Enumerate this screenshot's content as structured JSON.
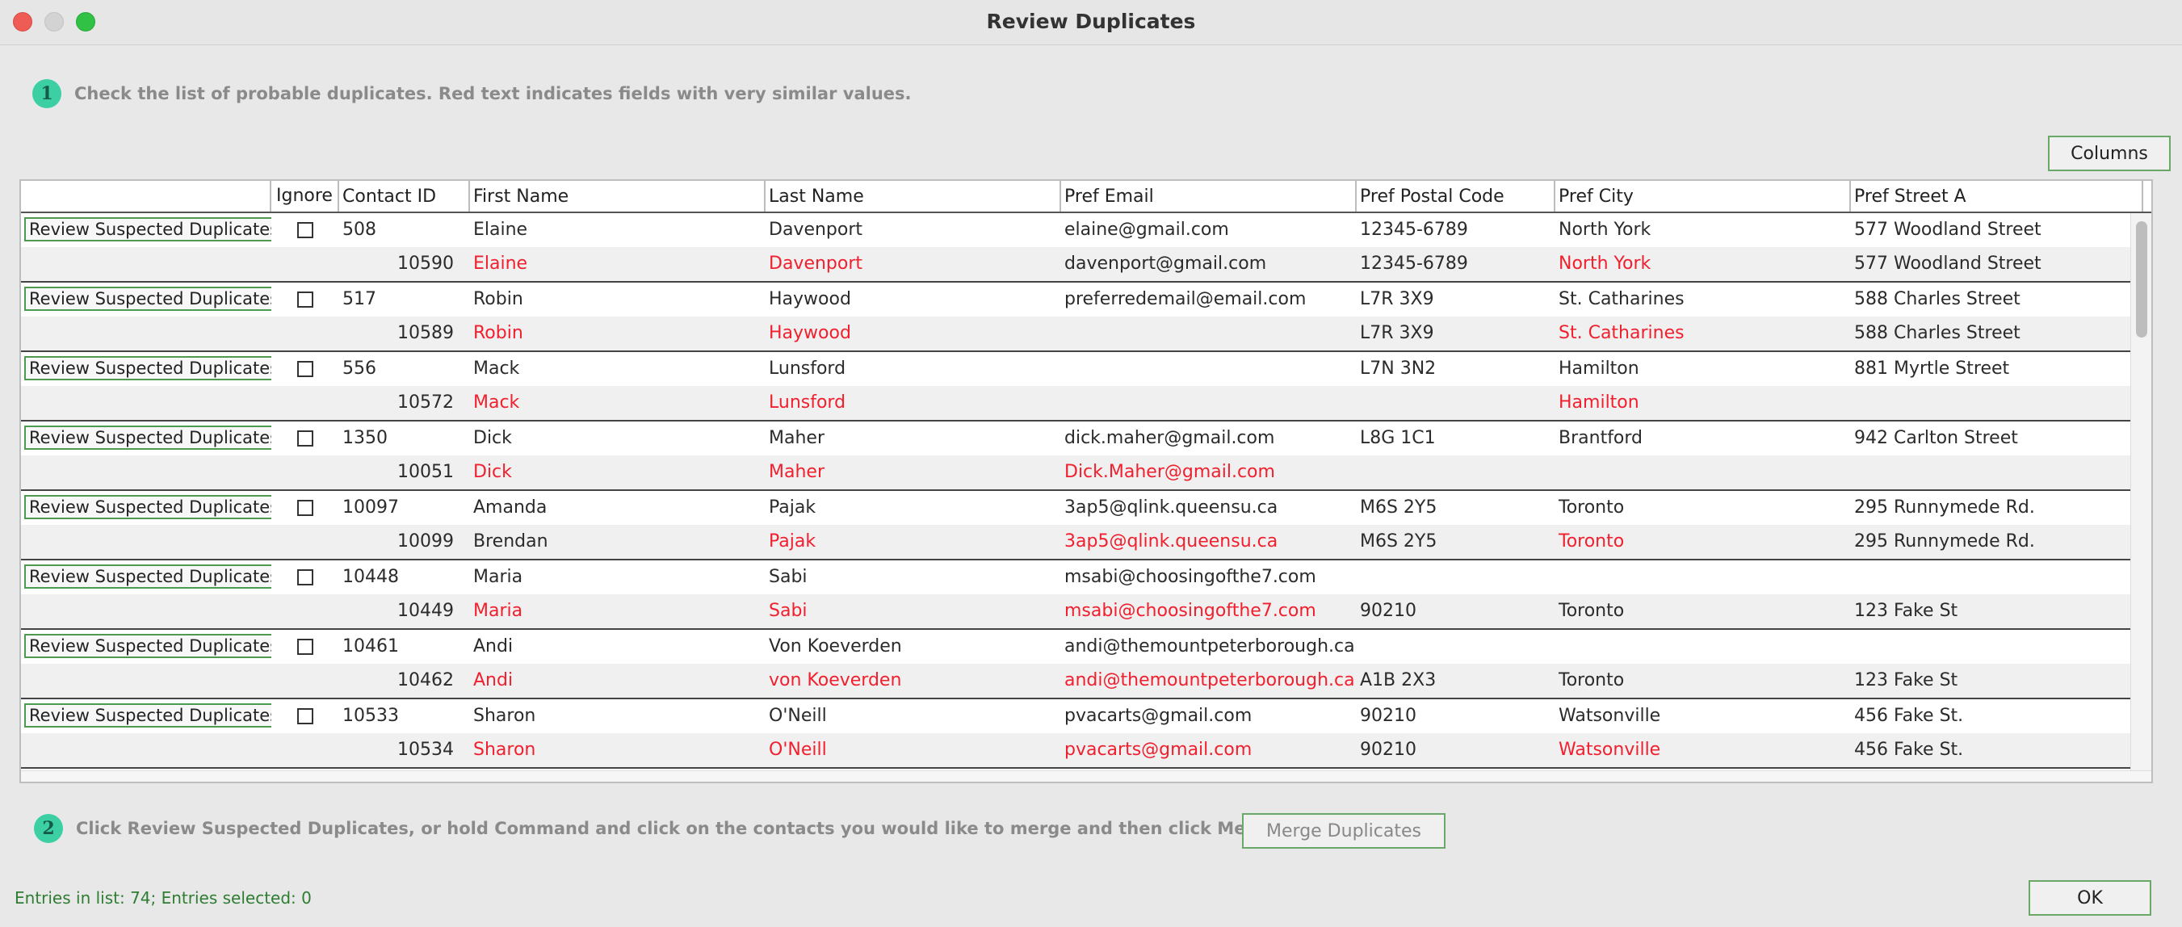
{
  "window": {
    "title": "Review Duplicates"
  },
  "step1": {
    "num": "1",
    "text": "Check the list of probable duplicates. Red text indicates fields with very similar values."
  },
  "step2": {
    "num": "2",
    "text": "Click Review Suspected Duplicates, or hold Command and click on the contacts you would like to merge and then click Merge Duplicates."
  },
  "buttons": {
    "columns": "Columns",
    "merge": "Merge Duplicates",
    "ok": "OK",
    "review": "Review Suspected Duplicates"
  },
  "table": {
    "headers": [
      "",
      "Ignore",
      "Contact ID",
      "First Name",
      "Last Name",
      "Pref Email",
      "Pref Postal Code",
      "Pref City",
      "Pref Street A"
    ],
    "groups": [
      {
        "primary": {
          "id": "508",
          "first": "Elaine",
          "last": "Davenport",
          "email": "elaine@gmail.com",
          "postal": "12345-6789",
          "city": "North York",
          "street": "577 Woodland Street"
        },
        "dup": {
          "id": "10590",
          "first": "Elaine",
          "last": "Davenport",
          "email": "davenport@gmail.com",
          "postal": "12345-6789",
          "city": "North York",
          "street": "577 Woodland Street"
        },
        "red": {
          "first": true,
          "last": true,
          "email": false,
          "postal": false,
          "city": true,
          "street": false
        }
      },
      {
        "primary": {
          "id": "517",
          "first": "Robin",
          "last": "Haywood",
          "email": "preferredemail@email.com",
          "postal": "L7R 3X9",
          "city": "St. Catharines",
          "street": "588 Charles Street"
        },
        "dup": {
          "id": "10589",
          "first": "Robin",
          "last": "Haywood",
          "email": "",
          "postal": "L7R 3X9",
          "city": "St. Catharines",
          "street": "588 Charles Street"
        },
        "red": {
          "first": true,
          "last": true,
          "email": false,
          "postal": false,
          "city": true,
          "street": false
        }
      },
      {
        "primary": {
          "id": "556",
          "first": "Mack",
          "last": "Lunsford",
          "email": "",
          "postal": "L7N 3N2",
          "city": "Hamilton",
          "street": "881 Myrtle Street"
        },
        "dup": {
          "id": "10572",
          "first": "Mack",
          "last": "Lunsford",
          "email": "",
          "postal": "",
          "city": "Hamilton",
          "street": ""
        },
        "red": {
          "first": true,
          "last": true,
          "email": false,
          "postal": false,
          "city": true,
          "street": false
        }
      },
      {
        "primary": {
          "id": "1350",
          "first": "Dick",
          "last": "Maher",
          "email": "dick.maher@gmail.com",
          "postal": "L8G 1C1",
          "city": "Brantford",
          "street": "942 Carlton Street"
        },
        "dup": {
          "id": "10051",
          "first": "Dick",
          "last": "Maher",
          "email": "Dick.Maher@gmail.com",
          "postal": "",
          "city": "",
          "street": ""
        },
        "red": {
          "first": true,
          "last": true,
          "email": true,
          "postal": false,
          "city": false,
          "street": false
        }
      },
      {
        "primary": {
          "id": "10097",
          "first": "Amanda",
          "last": "Pajak",
          "email": "3ap5@qlink.queensu.ca",
          "postal": "M6S 2Y5",
          "city": "Toronto",
          "street": "295 Runnymede Rd."
        },
        "dup": {
          "id": "10099",
          "first": "Brendan",
          "last": "Pajak",
          "email": "3ap5@qlink.queensu.ca",
          "postal": "M6S 2Y5",
          "city": "Toronto",
          "street": "295 Runnymede Rd."
        },
        "red": {
          "first": false,
          "last": true,
          "email": true,
          "postal": false,
          "city": true,
          "street": false
        }
      },
      {
        "primary": {
          "id": "10448",
          "first": "Maria",
          "last": "Sabi",
          "email": "msabi@choosingofthe7.com",
          "postal": "",
          "city": "",
          "street": ""
        },
        "dup": {
          "id": "10449",
          "first": "Maria",
          "last": "Sabi",
          "email": "msabi@choosingofthe7.com",
          "postal": "90210",
          "city": "Toronto",
          "street": "123 Fake St"
        },
        "red": {
          "first": true,
          "last": true,
          "email": true,
          "postal": false,
          "city": false,
          "street": false
        }
      },
      {
        "primary": {
          "id": "10461",
          "first": "Andi",
          "last": "Von Koeverden",
          "email": "andi@themountpeterborough.ca",
          "postal": "",
          "city": "",
          "street": ""
        },
        "dup": {
          "id": "10462",
          "first": "Andi",
          "last": "von Koeverden",
          "email": "andi@themountpeterborough.ca",
          "postal": "A1B 2X3",
          "city": "Toronto",
          "street": "123 Fake St"
        },
        "red": {
          "first": true,
          "last": true,
          "email": true,
          "postal": false,
          "city": false,
          "street": false
        }
      },
      {
        "primary": {
          "id": "10533",
          "first": "Sharon",
          "last": "O'Neill",
          "email": "pvacarts@gmail.com",
          "postal": "90210",
          "city": "Watsonville",
          "street": "456 Fake St."
        },
        "dup": {
          "id": "10534",
          "first": "Sharon",
          "last": "O'Neill",
          "email": "pvacarts@gmail.com",
          "postal": "90210",
          "city": "Watsonville",
          "street": "456 Fake St."
        },
        "red": {
          "first": true,
          "last": true,
          "email": true,
          "postal": false,
          "city": true,
          "street": false
        }
      }
    ]
  },
  "status": "Entries in list: 74; Entries selected: 0",
  "colors": {
    "accent_green": "#3ccfa4",
    "dup_red": "#f0202e",
    "border_green": "#4e9a4e"
  }
}
